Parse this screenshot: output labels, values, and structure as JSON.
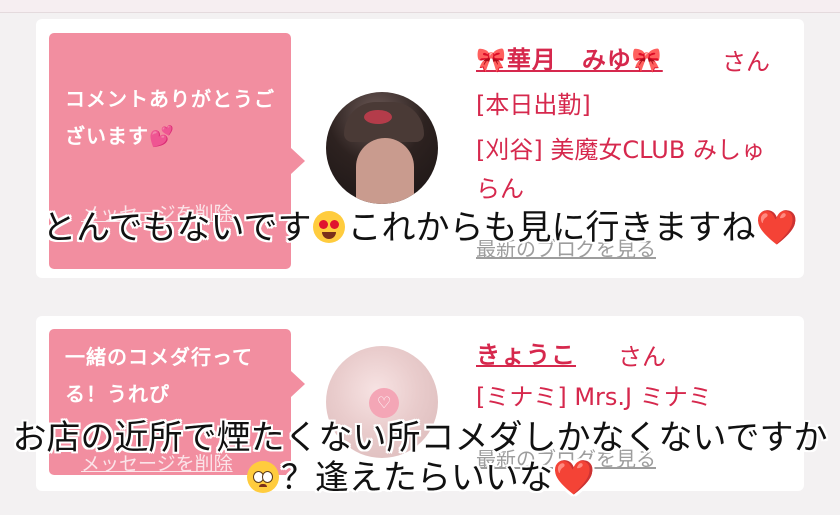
{
  "cards": [
    {
      "comment": "コメントありがとうございます💕",
      "delete_label": "メッセージを削除",
      "name": "🎀華月　みゆ🎀",
      "suffix": "さん",
      "status": "[本日出勤]",
      "shop": "[刈谷] 美魔女CLUB みしゅらん",
      "blog_label": "最新のブログを見る"
    },
    {
      "comment": "一緒のコメダ行ってる！うれぴ",
      "delete_label": "メッセージを削除",
      "name": "きょうこ",
      "suffix": "さん",
      "shop": "[ミナミ] Mrs.J ミナミ",
      "blog_label": "最新のブログを見る"
    }
  ],
  "captions": [
    {
      "part1": "とんでもないです",
      "emoji1": "heart-eyes-emoji",
      "part2": "これからも見に行きますね",
      "heart": "❤️"
    },
    {
      "part1": "お店の近所で煙たくない所コメダしかなくないですか",
      "emoji1": "pleading-face-emoji",
      "part2": "？逢えたらいいな",
      "heart": "❤️"
    }
  ],
  "colors": {
    "accent": "#d6284d",
    "bubble": "#f28ea0",
    "background": "#f3f1f2"
  }
}
